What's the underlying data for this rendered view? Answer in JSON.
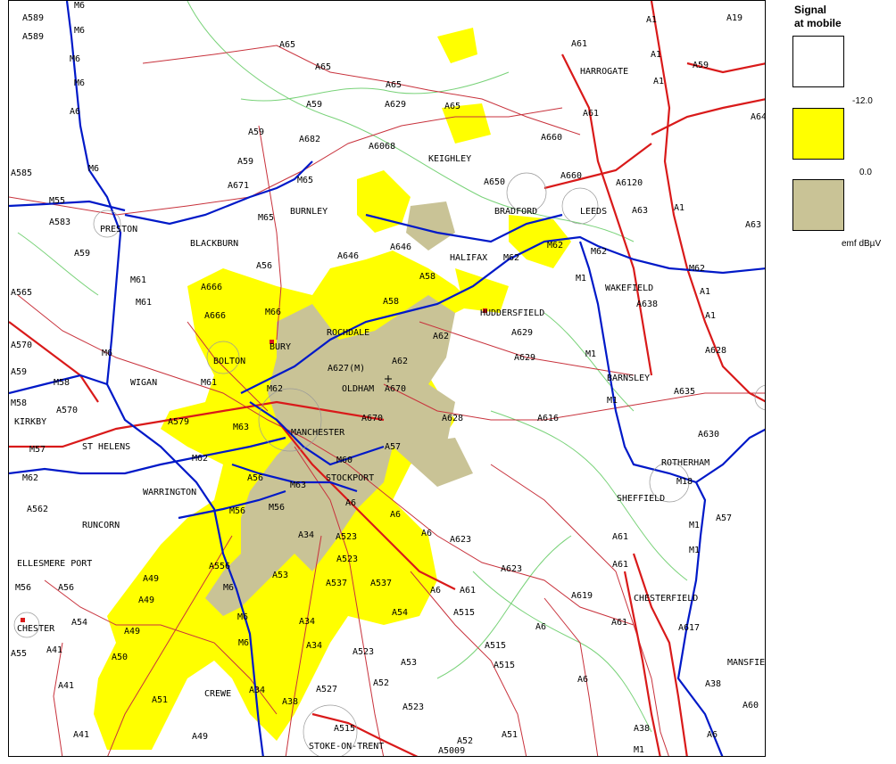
{
  "legend": {
    "title_line1": "Signal",
    "title_line2": "at mobile",
    "values": [
      "-12.0",
      "0.0"
    ],
    "unit": "emf dBµV",
    "colors": {
      "none": "#ffffff",
      "weak": "#ffff00",
      "strong": "#c9c396"
    }
  },
  "map_colors": {
    "motorway": "#0019c8",
    "primary": "#d91a1a",
    "a_road": "#c8323c",
    "boundary": "#78d278",
    "urban": "#9a9a9a",
    "coverage_weak": "#ffff00",
    "coverage_strong": "#c9c396"
  },
  "places": [
    "PRESTON",
    "BLACKBURN",
    "BURNLEY",
    "HARROGATE",
    "KEIGHLEY",
    "BRADFORD",
    "LEEDS",
    "HALIFAX",
    "HUDDERSFIELD",
    "WAKEFIELD",
    "ROCHDALE",
    "BURY",
    "BOLTON",
    "WIGAN",
    "OLDHAM",
    "MANCHESTER",
    "ST HELENS",
    "WARRINGTON",
    "STOCKPORT",
    "RUNCORN",
    "ELLESMERE PORT",
    "CHESTER",
    "BARNSLEY",
    "ROTHERHAM",
    "SHEFFIELD",
    "CHESTERFIELD",
    "CREWE",
    "STOKE-ON-TRENT",
    "KIRKBY",
    "MANSFIEL"
  ],
  "roads": [
    "A589",
    "A589",
    "M6",
    "M6",
    "M6",
    "M6",
    "A6",
    "M6",
    "A585",
    "M55",
    "A583",
    "A59",
    "A565",
    "A570",
    "A59",
    "M58",
    "M58",
    "A570",
    "M57",
    "M62",
    "A562",
    "ELL",
    "M56",
    "A56",
    "A55",
    "A41",
    "A41",
    "A41",
    "A54",
    "A65",
    "A65",
    "A65",
    "A629",
    "A65",
    "A660",
    "A1",
    "A19",
    "A61",
    "A1",
    "A59",
    "A1",
    "A64",
    "A61",
    "A59",
    "A682",
    "A6068",
    "A59",
    "M65",
    "A671",
    "A59",
    "A56",
    "M65",
    "A646",
    "A646",
    "A650",
    "A660",
    "A6120",
    "A63",
    "A1",
    "A63",
    "A58",
    "M62",
    "M62",
    "M62",
    "M1",
    "M62",
    "A1",
    "A58",
    "A62",
    "M66",
    "A666",
    "A666",
    "M61",
    "M61",
    "M6",
    "M61",
    "M62",
    "A627(M)",
    "A62",
    "A670",
    "A670",
    "A629",
    "A629",
    "A638",
    "M1",
    "A1",
    "A628",
    "M1",
    "A635",
    "M18",
    "A628",
    "A616",
    "A630",
    "A579",
    "M62",
    "M63",
    "M60",
    "A57",
    "A56",
    "M63",
    "A6",
    "M56",
    "M56",
    "A34",
    "A523",
    "A523",
    "A537",
    "A537",
    "A6",
    "A6",
    "A623",
    "A623",
    "A619",
    "A57",
    "A61",
    "M1",
    "M1",
    "A61",
    "A617",
    "A38",
    "A60",
    "A556",
    "M6",
    "A53",
    "A54",
    "A515",
    "A515",
    "A515",
    "A6",
    "A6",
    "A61",
    "A38",
    "A34",
    "A34",
    "A527",
    "A523",
    "A53",
    "A52",
    "A523",
    "A52",
    "A5009",
    "A515",
    "A51",
    "A51",
    "A49",
    "A49",
    "A49",
    "A49",
    "A50",
    "M6",
    "M6",
    "A34",
    "A38",
    "M1",
    "A6",
    "A6",
    "A61"
  ]
}
